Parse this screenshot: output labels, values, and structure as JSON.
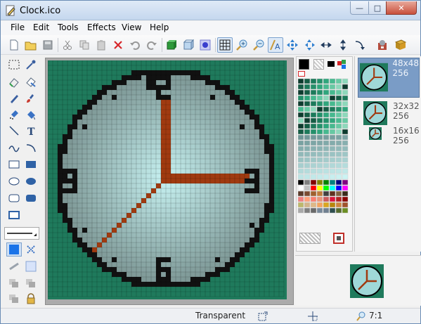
{
  "window": {
    "title": "Clock.ico"
  },
  "menu": [
    "File",
    "Edit",
    "Tools",
    "Effects",
    "View",
    "Help"
  ],
  "toolbar": [
    "new-icon",
    "open-icon",
    "save-icon",
    "cut-icon",
    "copy-icon",
    "paste-icon",
    "delete-icon",
    "undo-icon",
    "redo-icon",
    "cube-green-icon",
    "cube-blue-icon",
    "glow-icon",
    "grid-icon",
    "zoom-in-icon",
    "zoom-out-icon",
    "text-aa-icon",
    "move-arrows-icon",
    "flip-horizontal-icon",
    "flip-vertical-icon",
    "rotate-icon",
    "app-icon",
    "book-icon"
  ],
  "tools": [
    "select-rect",
    "pipette",
    "eraser",
    "bucket-eraser",
    "pencil",
    "brush",
    "spray",
    "fill",
    "line",
    "text",
    "curve",
    "arc",
    "rectangle-outline",
    "rectangle-filled",
    "ellipse-outline",
    "ellipse-filled",
    "rounded-outline",
    "rounded-filled",
    "rectangle-single",
    "",
    "line-width",
    "",
    "color-box",
    "blur",
    "brighten",
    "darken",
    "clone",
    "stamp",
    "group",
    "lock"
  ],
  "formats": [
    {
      "size": "48x48",
      "depth": "256"
    },
    {
      "size": "32x32",
      "depth": "256"
    },
    {
      "size": "16x16",
      "depth": "256"
    }
  ],
  "status": {
    "transparent": "Transparent",
    "zoom": "7:1"
  },
  "colors": {
    "background": "#1f7a5c",
    "hand": "#a03a10",
    "face_center": "#c7f2f2",
    "face_edge": "#7e9896"
  }
}
